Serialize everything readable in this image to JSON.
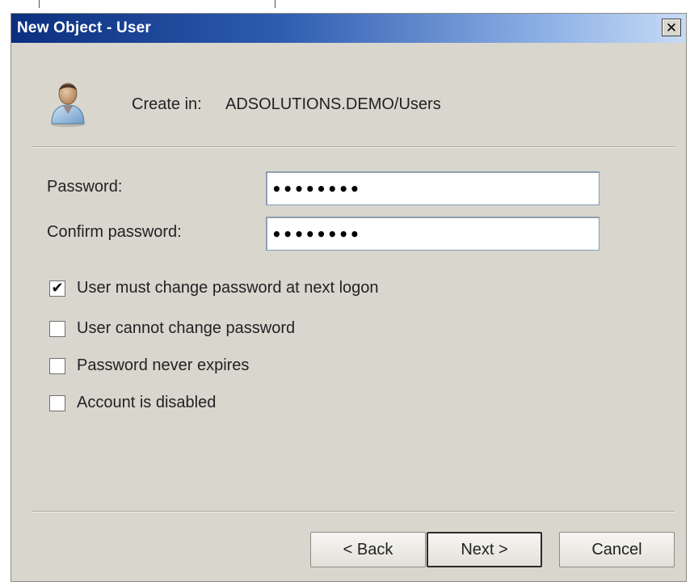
{
  "window": {
    "title": "New Object - User",
    "close_glyph": "✕"
  },
  "header": {
    "icon": "user-icon",
    "create_in_label": "Create in:",
    "create_in_value": "ADSOLUTIONS.DEMO/Users"
  },
  "password": {
    "label": "Password:",
    "value": "••••••••"
  },
  "confirm_password": {
    "label": "Confirm password:",
    "value": "••••••••"
  },
  "options": [
    {
      "label": "User must change password at next logon",
      "checked": true
    },
    {
      "label": "User cannot change password",
      "checked": false
    },
    {
      "label": "Password never expires",
      "checked": false
    },
    {
      "label": "Account is disabled",
      "checked": false
    }
  ],
  "buttons": {
    "back": "< Back",
    "next": "Next >",
    "cancel": "Cancel"
  },
  "colors": {
    "titlebar_start": "#0b2f7e",
    "titlebar_end": "#c7dbf5",
    "dialog_bg": "#d9d6ce"
  }
}
